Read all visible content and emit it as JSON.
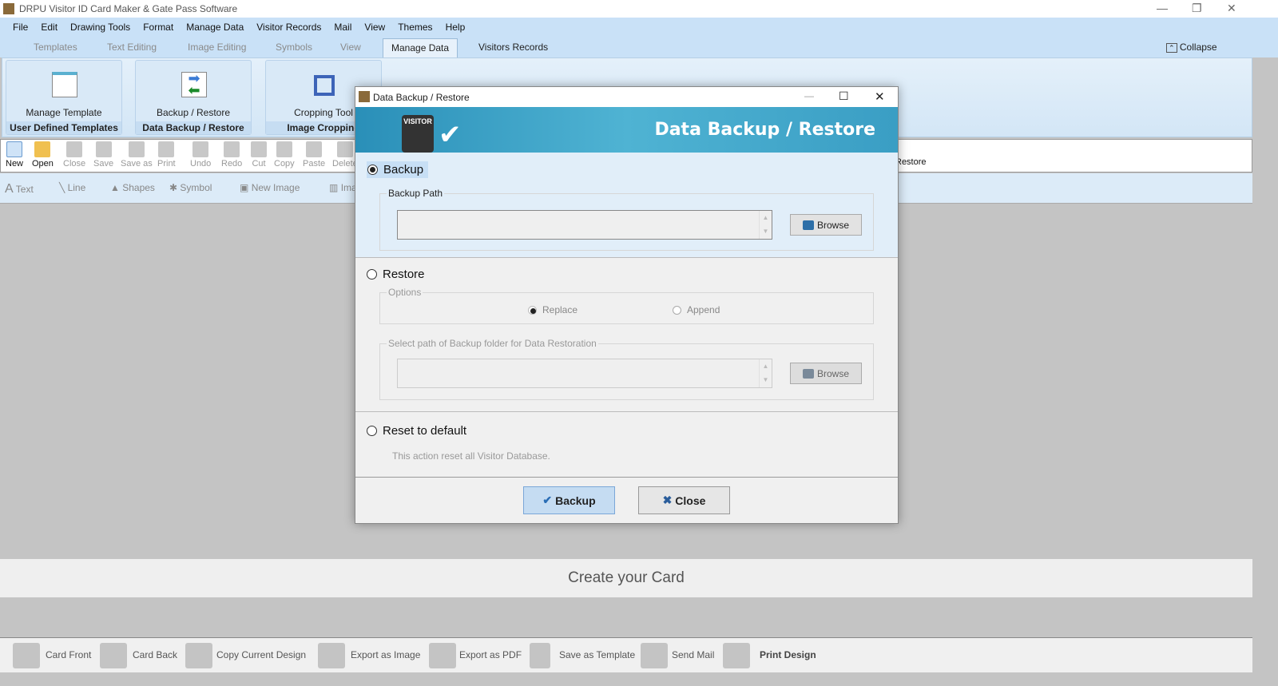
{
  "app": {
    "title": "DRPU Visitor ID Card Maker & Gate Pass Software"
  },
  "menu": [
    "File",
    "Edit",
    "Drawing Tools",
    "Format",
    "Manage Data",
    "Visitor Records",
    "Mail",
    "View",
    "Themes",
    "Help"
  ],
  "ribbon_tabs": [
    "Templates",
    "Text Editing",
    "Image Editing",
    "Symbols",
    "View",
    "Manage Data",
    "Visitors Records"
  ],
  "active_tab": "Manage Data",
  "collapse": "Collapse",
  "groups": [
    {
      "label": "Manage Template",
      "name": "User Defined Templates"
    },
    {
      "label": "Backup / Restore",
      "name": "Data Backup / Restore"
    },
    {
      "label": "Cropping Tool",
      "name": "Image Cropping"
    }
  ],
  "toolbar": [
    "New",
    "Open",
    "Close",
    "Save",
    "Save as",
    "Print",
    "Undo",
    "Redo",
    "Cut",
    "Copy",
    "Paste",
    "Delete"
  ],
  "toolbar_right": "Restore",
  "drawbar": [
    "Text",
    "Line",
    "Shapes",
    "Symbol",
    "New Image",
    "Image"
  ],
  "canvas_band": "Create your Card",
  "bottombar": [
    "Card Front",
    "Card Back",
    "Copy Current Design",
    "Export as Image",
    "Export as PDF",
    "Save as Template",
    "Send Mail",
    "Print Design"
  ],
  "dialog": {
    "title": "Data Backup / Restore",
    "banner": "Data Backup / Restore",
    "banner_badge": "VISITOR",
    "backup": {
      "label": "Backup",
      "selected": true,
      "path_legend": "Backup Path",
      "path_value": "",
      "browse": "Browse"
    },
    "restore": {
      "label": "Restore",
      "selected": false,
      "options_legend": "Options",
      "replace": "Replace",
      "append": "Append",
      "path_legend": "Select path of Backup folder for Data Restoration",
      "path_value": "",
      "browse": "Browse"
    },
    "reset": {
      "label": "Reset to default",
      "selected": false,
      "note": "This action reset all Visitor Database."
    },
    "ok_button": "Backup",
    "close_button": "Close"
  },
  "colors": {
    "accent": "#c9e1f7",
    "banner": "#3a9ec4"
  }
}
